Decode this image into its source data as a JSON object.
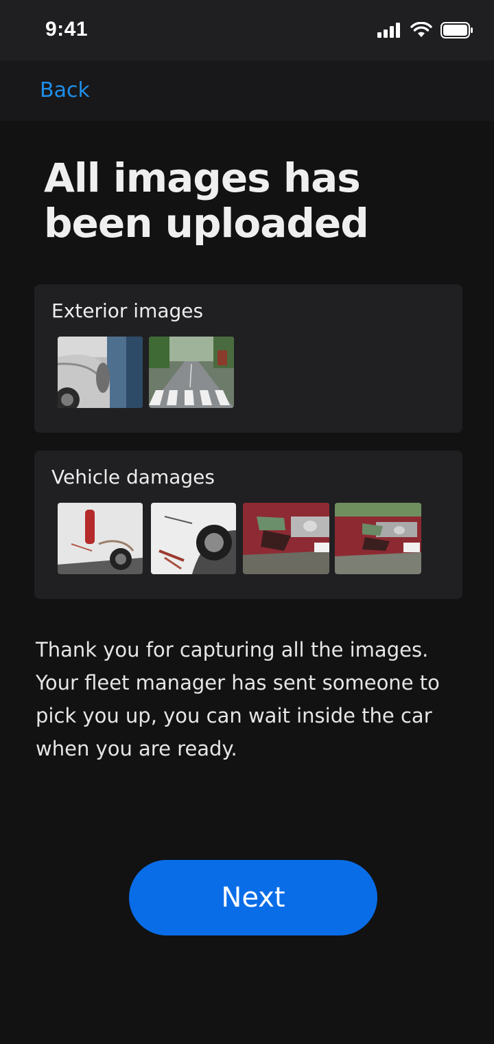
{
  "status_bar": {
    "time": "9:41",
    "icons": [
      "signal-icon",
      "wifi-icon",
      "battery-icon"
    ]
  },
  "nav": {
    "back_label": "Back"
  },
  "title": "All images has been uploaded",
  "sections": [
    {
      "title": "Exterior images",
      "images": [
        "car-rear-side-damage",
        "street-crosswalk"
      ]
    },
    {
      "title": "Vehicle damages",
      "images": [
        "white-van-side-damage",
        "white-car-bumper-damage",
        "red-car-front-damage",
        "red-car-front-damage-angle"
      ]
    }
  ],
  "message": "Thank you for capturing all the images. Your fleet manager has sent someone to pick you up, you can wait inside the car when you are ready.",
  "next_label": "Next",
  "colors": {
    "background": "#121213",
    "card": "#202022",
    "accent_link": "#1f8ee8",
    "primary_button": "#0a6de8"
  }
}
